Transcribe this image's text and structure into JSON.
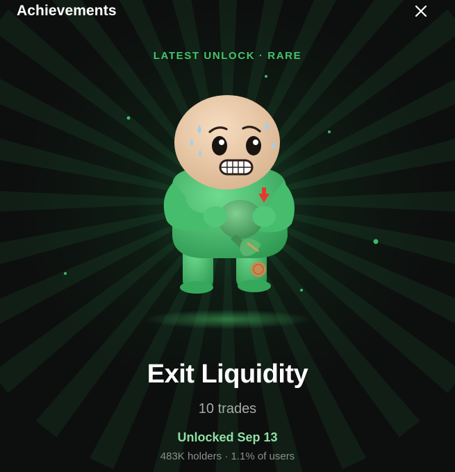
{
  "header": {
    "title": "Achievements",
    "close_icon": "close-icon"
  },
  "badge": {
    "eyebrow": "LATEST UNLOCK · RARE",
    "name": "Exit Liquidity",
    "criteria": "10 trades",
    "unlocked": "Unlocked Sep 13",
    "stats": "483K holders · 1.1% of users",
    "illustration_icon": "sweating-character-holding-money-bag"
  },
  "colors": {
    "background": "#0d0f0e",
    "accent_green": "#45c36a",
    "unlocked_green": "#8fe0a3",
    "character_green": "#3fb869",
    "muted_text": "#a7aaa8"
  }
}
